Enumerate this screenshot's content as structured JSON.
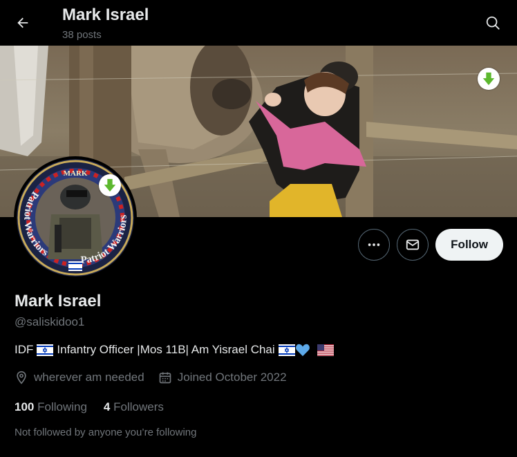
{
  "topbar": {
    "back_icon": "arrow-left-icon",
    "name": "Mark Israel",
    "posts": "38 posts",
    "search_icon": "search-icon"
  },
  "profile": {
    "display_name": "Mark Israel",
    "handle": "@saliskidoo1",
    "bio_parts": [
      "IDF",
      "Infantry Officer |Mos 11B| Am Yisrael Chai"
    ],
    "location": "wherever am needed",
    "joined": "Joined October 2022",
    "following_count": "100",
    "following_label": "Following",
    "followers_count": "4",
    "followers_label": "Followers",
    "not_followed": "Not followed by anyone you’re following"
  },
  "avatar": {
    "top_text": "MARK",
    "ring_text_left": "Patriot Warriors",
    "ring_text_right": "Patriot Warriors"
  },
  "actions": {
    "more_icon": "more-dots-icon",
    "message_icon": "envelope-icon",
    "follow_label": "Follow"
  },
  "colors": {
    "background": "#000000",
    "text_primary": "#e7e9ea",
    "text_secondary": "#71767b",
    "button_border": "#536471",
    "follow_bg": "#eff3f4",
    "download_green": "#5cb82e"
  }
}
